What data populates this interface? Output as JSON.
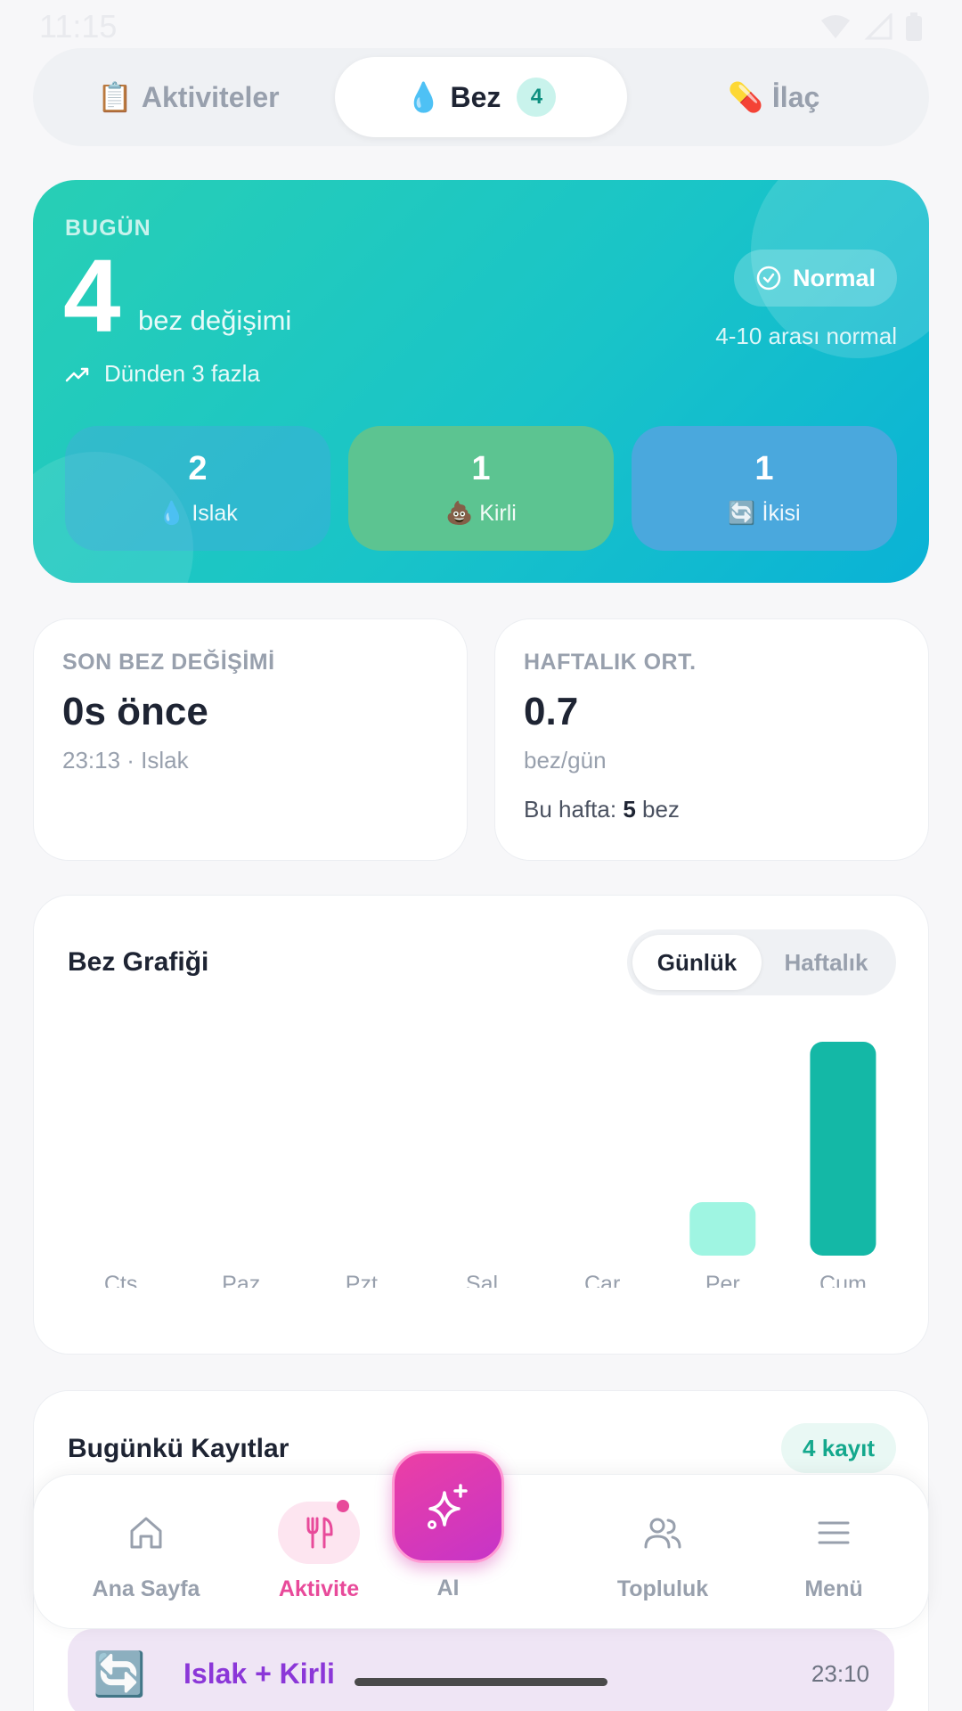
{
  "status_bar": {
    "time": "11:15"
  },
  "top_tabs": [
    {
      "icon": "📋",
      "label": "Aktiviteler",
      "active": false
    },
    {
      "icon": "💧",
      "label": "Bez",
      "badge": "4",
      "active": true
    },
    {
      "icon": "💊",
      "label": "İlaç",
      "active": false
    }
  ],
  "hero": {
    "label": "BUGÜN",
    "count": "4",
    "unit": "bez değişimi",
    "trend": "Dünden 3 fazla",
    "status": "Normal",
    "range_note": "4-10 arası normal",
    "stats": [
      {
        "value": "2",
        "icon": "💧",
        "label": "Islak"
      },
      {
        "value": "1",
        "icon": "💩",
        "label": "Kirli"
      },
      {
        "value": "1",
        "icon": "🔄",
        "label": "İkisi"
      }
    ]
  },
  "last_change": {
    "title": "SON BEZ DEĞİŞİMİ",
    "value": "0s önce",
    "sub": "23:13 · Islak"
  },
  "weekly_avg": {
    "title": "HAFTALIK ORT.",
    "value": "0.7",
    "unit": "bez/gün",
    "week_prefix": "Bu hafta: ",
    "week_count": "5",
    "week_suffix": " bez"
  },
  "chart": {
    "title": "Bez Grafiği",
    "segments": [
      "Günlük",
      "Haftalık"
    ],
    "active_segment": "Günlük"
  },
  "chart_data": {
    "type": "bar",
    "categories": [
      "Cts",
      "Paz",
      "Pzt",
      "Sal",
      "Çar",
      "Per",
      "Cum"
    ],
    "values": [
      0,
      0,
      0,
      0,
      0,
      1,
      4
    ],
    "ylim": [
      0,
      4
    ],
    "colors": [
      "#9ff5e2",
      "#9ff5e2",
      "#9ff5e2",
      "#9ff5e2",
      "#9ff5e2",
      "#9ff5e2",
      "#14b8a6"
    ],
    "title": "Bez Grafiği"
  },
  "records": {
    "title": "Bugünkü Kayıtlar",
    "count_label": "4 kayıt",
    "items": [
      {
        "icon": "🔄",
        "label": "Islak + Kirli",
        "time": "23:10"
      }
    ]
  },
  "bottom_nav": {
    "items": [
      {
        "label": "Ana Sayfa",
        "icon": "home-icon"
      },
      {
        "label": "Aktivite",
        "icon": "utensils-icon",
        "active": true
      },
      {
        "label": "AI",
        "icon": "sparkle-icon"
      },
      {
        "label": "Topluluk",
        "icon": "users-icon"
      },
      {
        "label": "Menü",
        "icon": "menu-icon"
      }
    ]
  }
}
